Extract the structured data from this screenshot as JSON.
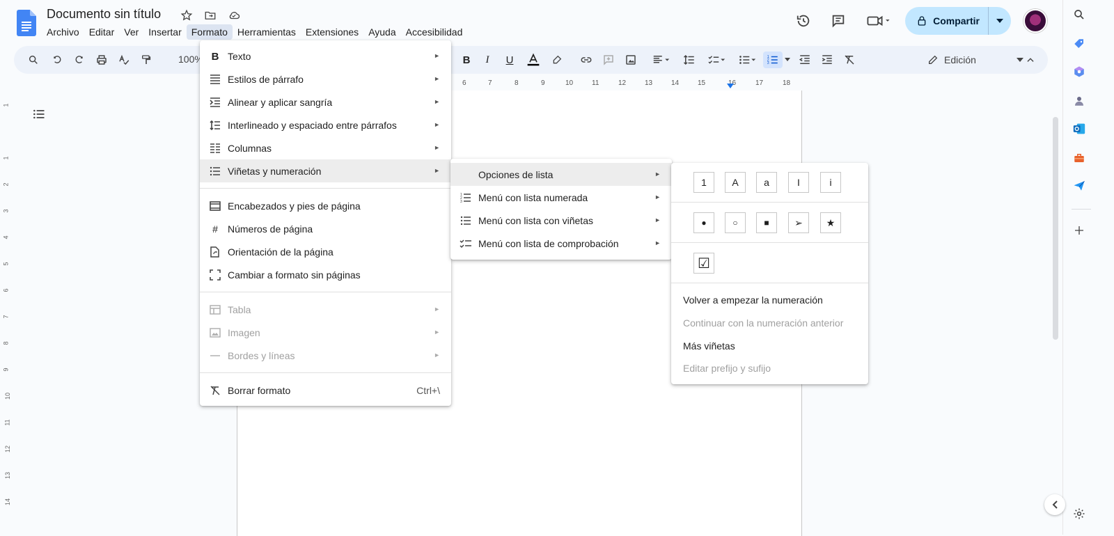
{
  "doc": {
    "title": "Documento sin título"
  },
  "menubar": [
    "Archivo",
    "Editar",
    "Ver",
    "Insertar",
    "Formato",
    "Herramientas",
    "Extensiones",
    "Ayuda",
    "Accesibilidad"
  ],
  "toolbar": {
    "zoom": "100%",
    "mode": "Edición"
  },
  "share": {
    "label": "Compartir"
  },
  "ruler": [
    "6",
    "7",
    "8",
    "9",
    "10",
    "11",
    "12",
    "13",
    "14",
    "15",
    "16",
    "17",
    "18"
  ],
  "vruler": [
    "1",
    "1",
    "2",
    "3",
    "4",
    "5",
    "6",
    "7",
    "8",
    "9",
    "10",
    "11",
    "12",
    "13",
    "14"
  ],
  "format_menu": {
    "texto": "Texto",
    "estilos": "Estilos de párrafo",
    "alinear": "Alinear y aplicar sangría",
    "interlineado": "Interlineado y espaciado entre párrafos",
    "columnas": "Columnas",
    "vinetas": "Viñetas y numeración",
    "encabezados": "Encabezados y pies de página",
    "numeros": "Números de página",
    "orientacion": "Orientación de la página",
    "sinpaginas": "Cambiar a formato sin páginas",
    "tabla": "Tabla",
    "imagen": "Imagen",
    "bordes": "Bordes y líneas",
    "borrar": "Borrar formato",
    "borrar_shortcut": "Ctrl+\\"
  },
  "list_menu": {
    "opciones": "Opciones de lista",
    "numerada": "Menú con lista numerada",
    "vinetas": "Menú con lista con viñetas",
    "comprobacion": "Menú con lista de comprobación"
  },
  "options_menu": {
    "numbering": [
      "1",
      "A",
      "a",
      "I",
      "i"
    ],
    "bullets": [
      "●",
      "○",
      "■",
      "➢",
      "★"
    ],
    "checkbox": "☑",
    "reiniciar": "Volver a empezar la numeración",
    "continuar": "Continuar con la numeración anterior",
    "mas": "Más viñetas",
    "prefijo": "Editar prefijo y sufijo"
  }
}
